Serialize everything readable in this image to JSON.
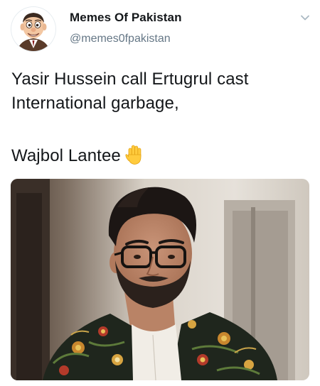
{
  "tweet": {
    "author_name": "Memes Of Pakistan",
    "author_handle": "@memes0fpakistan",
    "text_line1": "Yasir Hussein call Ertugrul cast",
    "text_line2": "International garbage,",
    "text_line3": "Wajbol Lantee",
    "emoji": "raised-hand-emoji",
    "menu_icon": "chevron-down-icon",
    "avatar_icon": "cartoon-avatar-icon"
  },
  "colors": {
    "text_primary": "#14171a",
    "text_secondary": "#657786",
    "chevron": "#aab8c2"
  }
}
